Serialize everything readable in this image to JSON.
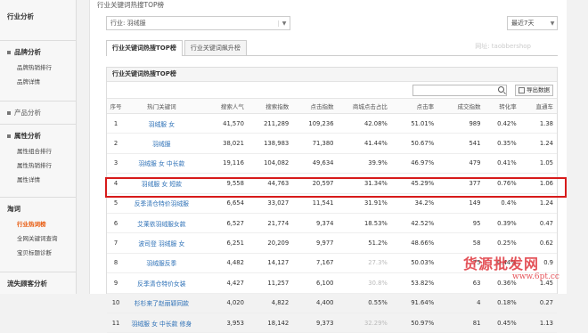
{
  "page": {
    "title": "行业关键词热搜TOP榜"
  },
  "sidebar": {
    "sections": [
      {
        "head": "行业分析",
        "items": []
      },
      {
        "head": "品牌分析",
        "items": [
          "品牌热销排行",
          "品牌详情"
        ]
      },
      {
        "head": "产品分析",
        "items": []
      },
      {
        "head": "属性分析",
        "items": [
          "属性组合排行",
          "属性热销排行",
          "属性详情"
        ]
      },
      {
        "head": "淘词",
        "items": [
          "行业热词榜",
          "全网关键词查询",
          "宝贝标题诊断"
        ]
      },
      {
        "head": "流失顾客分析",
        "items": []
      }
    ],
    "active_item": "行业热词榜"
  },
  "filter": {
    "value": "行业: 羽绒服"
  },
  "date_range": {
    "value": "最近7天"
  },
  "tabs": [
    "行业关键词热搜TOP榜",
    "行业关键词飙升榜"
  ],
  "watermark": "网址: taobbershop",
  "panel_title": "行业关键词热搜TOP榜",
  "export_label": "导出数据",
  "table": {
    "headers": [
      "序号",
      "热门关键词",
      "搜索人气",
      "搜索指数",
      "点击指数",
      "商城点击占比",
      "点击率",
      "成交指数",
      "转化率",
      "直通车"
    ],
    "rows": [
      [
        "1",
        "羽绒服 女",
        "41,570",
        "211,289",
        "109,236",
        "42.08%",
        "51.01%",
        "989",
        "0.42%",
        "1.38"
      ],
      [
        "2",
        "羽绒服",
        "38,021",
        "138,983",
        "71,380",
        "41.44%",
        "50.67%",
        "541",
        "0.35%",
        "1.24"
      ],
      [
        "3",
        "羽绒服 女 中长款",
        "19,116",
        "104,082",
        "49,634",
        "39.9%",
        "46.97%",
        "479",
        "0.41%",
        "1.05"
      ],
      [
        "4",
        "羽绒服 女 短款",
        "9,558",
        "44,763",
        "20,597",
        "31.34%",
        "45.29%",
        "377",
        "0.76%",
        "1.06"
      ],
      [
        "5",
        "反季清仓特价羽绒服",
        "6,654",
        "33,027",
        "11,541",
        "31.91%",
        "34.2%",
        "149",
        "0.4%",
        "1.24"
      ],
      [
        "6",
        "艾莱依羽绒服女款",
        "6,527",
        "21,774",
        "9,374",
        "18.53%",
        "42.52%",
        "95",
        "0.39%",
        "0.47"
      ],
      [
        "7",
        "波司登 羽绒服 女",
        "6,251",
        "20,209",
        "9,977",
        "51.2%",
        "48.66%",
        "58",
        "0.25%",
        "0.62"
      ],
      [
        "8",
        "羽绒服反季",
        "4,482",
        "14,127",
        "7,167",
        "27.3%",
        "50.03%",
        "75",
        "0.44%",
        "0.9"
      ],
      [
        "9",
        "反季清仓特价女装",
        "4,427",
        "11,257",
        "6,100",
        "30.8%",
        "53.82%",
        "63",
        "0.36%",
        "1.45"
      ],
      [
        "10",
        "杉杉来了赵丽颖同款",
        "4,020",
        "4,822",
        "4,400",
        "0.55%",
        "91.64%",
        "4",
        "0.18%",
        "0.27"
      ],
      [
        "11",
        "羽绒服 女 中长款 修身",
        "3,953",
        "18,142",
        "9,373",
        "32.29%",
        "50.97%",
        "81",
        "0.45%",
        "1.13"
      ]
    ]
  },
  "brand": {
    "text": "货源批发网",
    "url": "www.6pt.cc"
  }
}
